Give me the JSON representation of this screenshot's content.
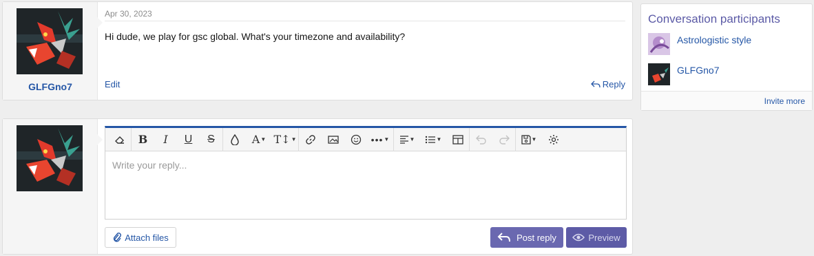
{
  "message": {
    "username": "GLFGno7",
    "date": "Apr 30, 2023",
    "body": "Hi dude, we play for gsc global. What's your timezone and availability?",
    "edit_label": "Edit",
    "reply_label": "Reply"
  },
  "editor": {
    "placeholder": "Write your reply...",
    "toolbar": [
      {
        "icon": "eraser-icon"
      },
      {
        "icon": "bold-icon"
      },
      {
        "icon": "italic-icon"
      },
      {
        "icon": "underline-icon"
      },
      {
        "icon": "strikethrough-icon"
      },
      {
        "icon": "color-drop-icon"
      },
      {
        "icon": "font-family-icon"
      },
      {
        "icon": "font-size-icon"
      },
      {
        "icon": "link-icon"
      },
      {
        "icon": "image-icon"
      },
      {
        "icon": "smiley-icon"
      },
      {
        "icon": "more-icon"
      },
      {
        "icon": "align-icon"
      },
      {
        "icon": "list-icon"
      },
      {
        "icon": "table-icon"
      },
      {
        "icon": "undo-icon"
      },
      {
        "icon": "redo-icon"
      },
      {
        "icon": "drafts-icon"
      },
      {
        "icon": "settings-icon"
      }
    ],
    "attach_label": "Attach files",
    "post_label": "Post reply",
    "preview_label": "Preview",
    "accent_color": "#2456a6",
    "button_color": "#6a68b0"
  },
  "sidebar": {
    "title": "Conversation participants",
    "participants": [
      {
        "name": "Astrologistic style"
      },
      {
        "name": "GLFGno7"
      }
    ],
    "invite_label": "Invite more"
  }
}
